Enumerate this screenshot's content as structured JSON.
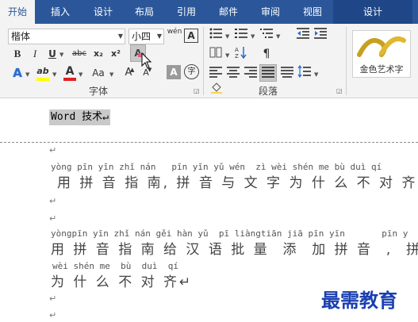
{
  "tabs": [
    {
      "label": "开始",
      "active": true
    },
    {
      "label": "插入"
    },
    {
      "label": "设计"
    },
    {
      "label": "布局"
    },
    {
      "label": "引用"
    },
    {
      "label": "邮件"
    },
    {
      "label": "审阅"
    },
    {
      "label": "视图"
    },
    {
      "label": "设计",
      "context": true
    }
  ],
  "font_group": {
    "font_name": "楷体",
    "font_size": "小四",
    "pinyin_button": "wén",
    "border_button": "A",
    "bold": "B",
    "italic": "I",
    "underline": "U",
    "strike": "abc",
    "subscript": "x₂",
    "superscript": "x²",
    "clear_format": "A",
    "text_effect": "A",
    "highlight": "ab",
    "font_color": "A",
    "change_case": "Aa",
    "grow_font": "A",
    "shrink_font": "A",
    "char_shading": "A",
    "enclose_char": "字",
    "label": "字体"
  },
  "paragraph_group": {
    "label": "段落"
  },
  "styles_group": {
    "wordart_label": "金色艺术字"
  },
  "document": {
    "title": "Word 技术↵",
    "para_mark": "↵",
    "line1_pinyin": "yòng pīn yīn zhǐ nán   pīn yīn yǔ wén  zì wèi shén me bù duì qí",
    "line1_text": "用 拼 音 指 南, 拼 音 与 文 字 为 什 么 不 对 齐?↵",
    "line2_pinyin": "yòngpīn yīn zhǐ nán gěi hàn yǔ  pī liàngtiān jiā pīn yīn       pīn y",
    "line2_text": "用 拼 音 指 南 给 汉 语 批 量  添  加 拼 音  ,  拼",
    "line3_pinyin": "wèi shén me  bù  duì  qí",
    "line3_text": "为 什 么 不 对 齐↵",
    "watermark": "最需教育"
  }
}
